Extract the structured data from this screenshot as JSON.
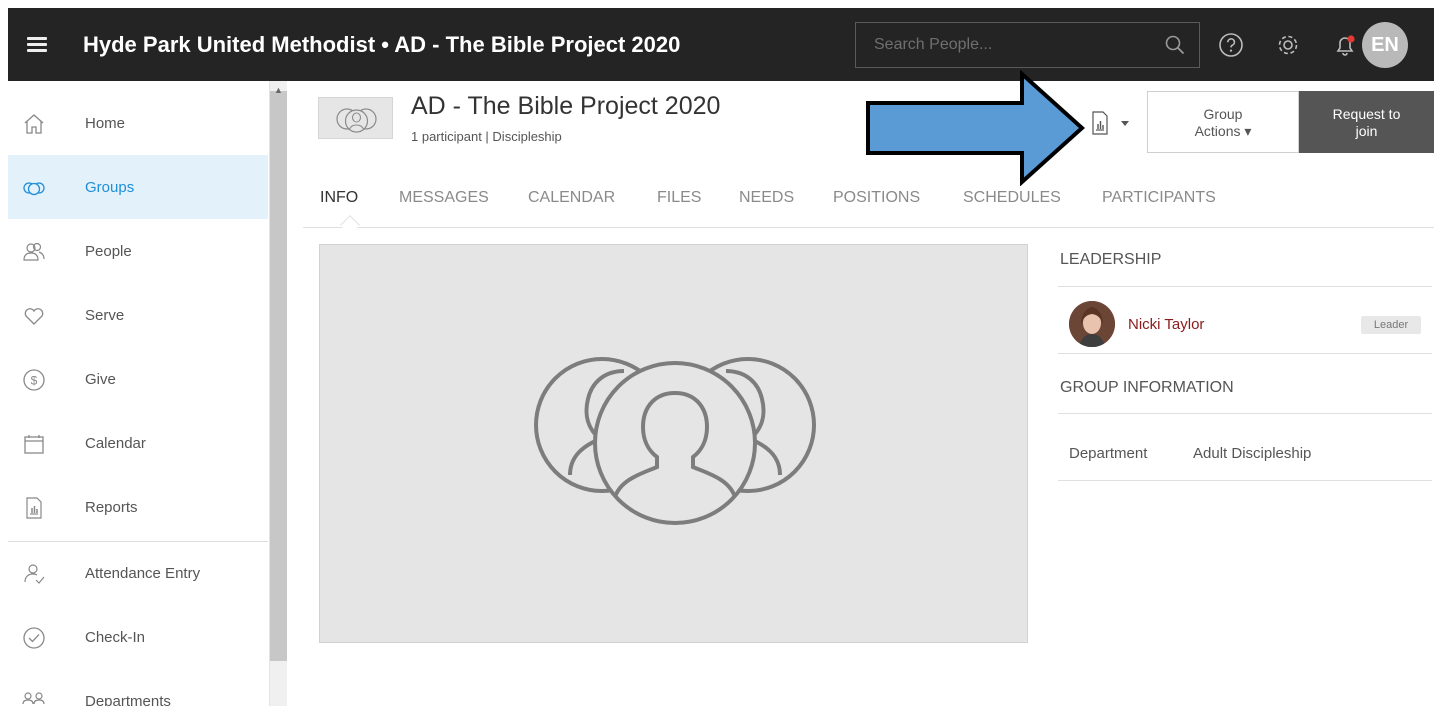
{
  "topbar": {
    "title": "Hyde Park United Methodist • AD - The Bible Project 2020",
    "search_placeholder": "Search People...",
    "avatar_initials": "EN"
  },
  "sidebar": {
    "items": [
      {
        "label": "Home",
        "icon": "home-icon"
      },
      {
        "label": "Groups",
        "icon": "groups-icon",
        "active": true
      },
      {
        "label": "People",
        "icon": "people-icon"
      },
      {
        "label": "Serve",
        "icon": "heart-icon"
      },
      {
        "label": "Give",
        "icon": "dollar-icon"
      },
      {
        "label": "Calendar",
        "icon": "calendar-icon"
      },
      {
        "label": "Reports",
        "icon": "reports-icon"
      },
      {
        "label": "Attendance Entry",
        "icon": "attendance-icon"
      },
      {
        "label": "Check-In",
        "icon": "check-icon"
      },
      {
        "label": "Departments",
        "icon": "departments-icon"
      }
    ]
  },
  "group": {
    "title": "AD - The Bible Project 2020",
    "subtitle": "1 participant | Discipleship",
    "actions_label_line1": "Group",
    "actions_label_line2": "Actions ▾",
    "join_label_line1": "Request to",
    "join_label_line2": "join"
  },
  "tabs": [
    "INFO",
    "MESSAGES",
    "CALENDAR",
    "FILES",
    "NEEDS",
    "POSITIONS",
    "SCHEDULES",
    "PARTICIPANTS"
  ],
  "right_panel": {
    "leadership_heading": "LEADERSHIP",
    "leader_name": "Nicki Taylor",
    "leader_role": "Leader",
    "group_info_heading": "GROUP INFORMATION",
    "info_key": "Department",
    "info_value": "Adult Discipleship"
  },
  "colors": {
    "topbar": "#242424",
    "active_nav": "#1f8fd6",
    "active_nav_bg": "#e3f1fb",
    "leader_name": "#8b1a1a",
    "annotation_arrow": "#5b9bd5"
  }
}
